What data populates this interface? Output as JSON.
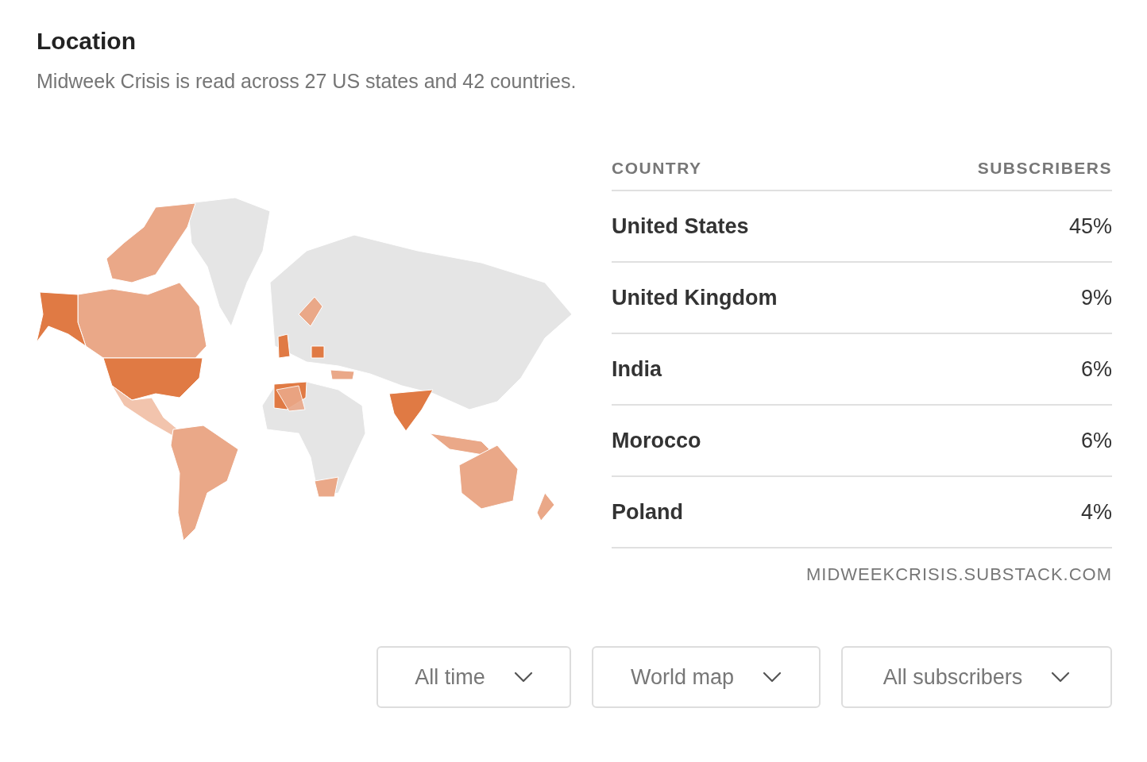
{
  "title": "Location",
  "subtitle": "Midweek Crisis is read across 27 US states and 42 countries.",
  "table": {
    "columns": [
      "COUNTRY",
      "SUBSCRIBERS"
    ],
    "rows": [
      {
        "country": "United States",
        "share": "45%"
      },
      {
        "country": "United Kingdom",
        "share": "9%"
      },
      {
        "country": "India",
        "share": "6%"
      },
      {
        "country": "Morocco",
        "share": "6%"
      },
      {
        "country": "Poland",
        "share": "4%"
      }
    ]
  },
  "source": "MIDWEEKCRISIS.SUBSTACK.COM",
  "filters": [
    {
      "label": "All time"
    },
    {
      "label": "World map"
    },
    {
      "label": "All subscribers"
    }
  ]
}
